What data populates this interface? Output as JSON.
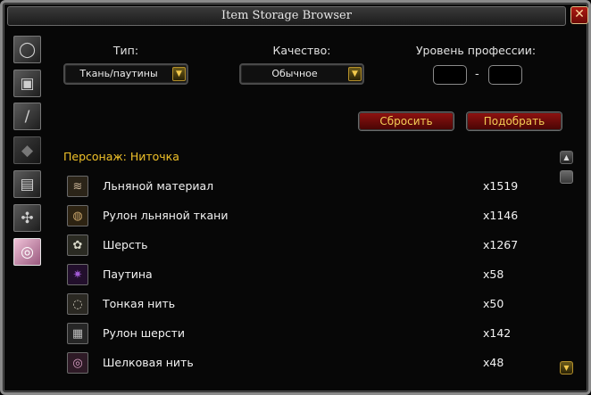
{
  "window": {
    "title": "Item Storage Browser",
    "close_glyph": "✕"
  },
  "sidebar": {
    "tabs": [
      {
        "icon": "ring-icon",
        "glyph": "◯"
      },
      {
        "icon": "chest-armor-icon",
        "glyph": "▣"
      },
      {
        "icon": "sword-icon",
        "glyph": "/"
      },
      {
        "icon": "gem-icon",
        "glyph": "◆"
      },
      {
        "icon": "plate-gear-icon",
        "glyph": "▤"
      },
      {
        "icon": "tools-icon",
        "glyph": "✣"
      },
      {
        "icon": "cloth-icon",
        "glyph": "◎"
      }
    ]
  },
  "filters": {
    "type_label": "Тип:",
    "type_value": "Ткань/паутины",
    "quality_label": "Качество:",
    "quality_value": "Обычное",
    "profession_label": "Уровень профессии:",
    "level_separator": "-",
    "level_min": "",
    "level_max": "",
    "dropdown_arrow_glyph": "▼"
  },
  "buttons": {
    "reset": "Сбросить",
    "select": "Подобрать"
  },
  "character_label": "Персонаж: Ниточка",
  "items": [
    {
      "name": "Льняной материал",
      "count": "x1519",
      "icon": "linen-cloth-icon",
      "color": "#cdb79a",
      "glyph": "≋"
    },
    {
      "name": "Рулон льняной ткани",
      "count": "x1146",
      "icon": "linen-bolt-icon",
      "color": "#c7a46b",
      "glyph": "◍"
    },
    {
      "name": "Шерсть",
      "count": "x1267",
      "icon": "wool-cloth-icon",
      "color": "#d8d8c8",
      "glyph": "✿"
    },
    {
      "name": "Паутина",
      "count": "x58",
      "icon": "cobweb-icon",
      "color": "#a35bd6",
      "glyph": "✷"
    },
    {
      "name": "Тонкая нить",
      "count": "x50",
      "icon": "thread-icon",
      "color": "#d6d1c2",
      "glyph": "◌"
    },
    {
      "name": "Рулон шерсти",
      "count": "x142",
      "icon": "wool-bolt-icon",
      "color": "#bcbcbc",
      "glyph": "▦"
    },
    {
      "name": "Шелковая нить",
      "count": "x48",
      "icon": "silk-thread-icon",
      "color": "#d99fc4",
      "glyph": "◎"
    }
  ],
  "scrollbar": {
    "up_glyph": "▲",
    "down_glyph": "▼"
  },
  "colors": {
    "accent_gold": "#f0c229",
    "button_red": "#8e1210"
  }
}
